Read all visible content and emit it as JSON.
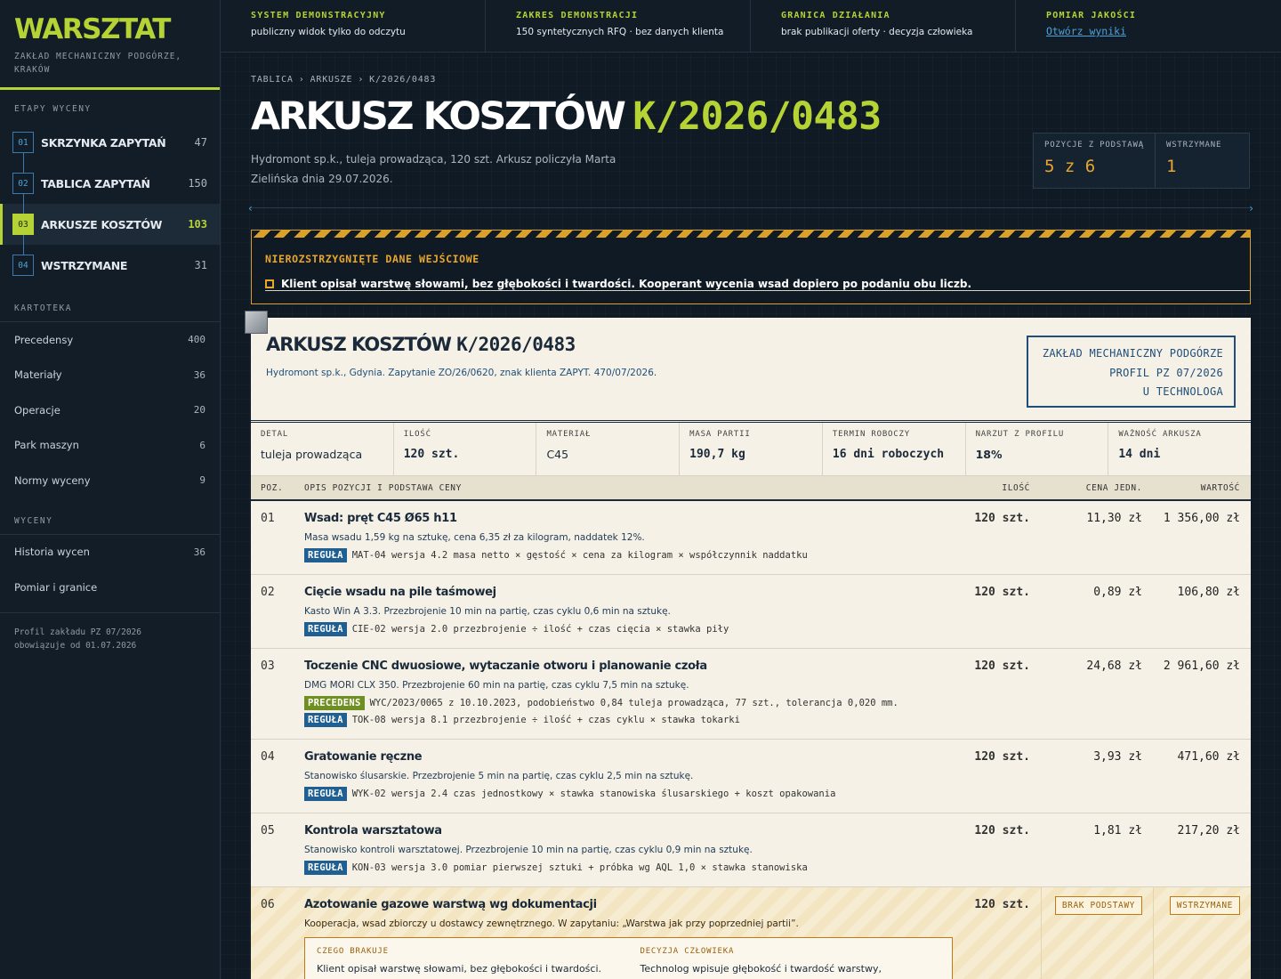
{
  "brand": {
    "name": "WARSZTAT",
    "subtitle": "ZAKŁAD MECHANICZNY PODGÓRZE, KRAKÓW"
  },
  "sidebar": {
    "stages_title": "ETAPY WYCENY",
    "stages": [
      {
        "num": "01",
        "label": "SKRZYNKA ZAPYTAŃ",
        "count": "47"
      },
      {
        "num": "02",
        "label": "TABLICA ZAPYTAŃ",
        "count": "150"
      },
      {
        "num": "03",
        "label": "ARKUSZE KOSZTÓW",
        "count": "103"
      },
      {
        "num": "04",
        "label": "WSTRZYMANE",
        "count": "31"
      }
    ],
    "kartoteka_title": "KARTOTEKA",
    "kartoteka": [
      {
        "label": "Precedensy",
        "count": "400"
      },
      {
        "label": "Materiały",
        "count": "36"
      },
      {
        "label": "Operacje",
        "count": "20"
      },
      {
        "label": "Park maszyn",
        "count": "6"
      },
      {
        "label": "Normy wyceny",
        "count": "9"
      }
    ],
    "wyceny_title": "WYCENY",
    "wyceny": [
      {
        "label": "Historia wycen",
        "count": "36"
      },
      {
        "label": "Pomiar i granice",
        "count": ""
      }
    ],
    "footer_line1": "Profil zakładu PZ 07/2026",
    "footer_line2": "obowiązuje od 01.07.2026"
  },
  "topbar": [
    {
      "title": "SYSTEM DEMONSTRACYJNY",
      "value": "publiczny widok tylko do odczytu"
    },
    {
      "title": "ZAKRES DEMONSTRACJI",
      "value": "150 syntetycznych RFQ · bez danych klienta"
    },
    {
      "title": "GRANICA DZIAŁANIA",
      "value": "brak publikacji oferty · decyzja człowieka"
    },
    {
      "title": "POMIAR JAKOŚCI",
      "link": "Otwórz wyniki"
    }
  ],
  "breadcrumb": [
    "TABLICA",
    "ARKUSZE",
    "K/2026/0483"
  ],
  "breadcrumb_sep": "›",
  "page": {
    "title_a": "ARKUSZ KOSZTÓW",
    "title_b": "K/2026/0483",
    "subtitle": "Hydromont sp.k., tuleja prowadząca, 120 szt. Arkusz policzyła Marta Zielińska dnia 29.07.2026."
  },
  "stats": [
    {
      "label": "POZYCJE Z PODSTAWĄ",
      "value": "5 z 6"
    },
    {
      "label": "WSTRZYMANE",
      "value": "1"
    }
  ],
  "warning": {
    "title": "NIEROZSTRZYGNIĘTE DANE WEJŚCIOWE",
    "message": "Klient opisał warstwę słowami, bez głębokości i twardości. Kooperant wycenia wsad dopiero po podaniu obu liczb."
  },
  "sheet": {
    "title_a": "ARKUSZ KOSZTÓW",
    "title_b": "K/2026/0483",
    "subtitle": "Hydromont sp.k., Gdynia. Zapytanie ZO/26/0620, znak klienta ZAPYT. 470/07/2026.",
    "stamp": [
      "ZAKŁAD MECHANICZNY PODGÓRZE",
      "PROFIL PZ 07/2026",
      "U TECHNOLOGA"
    ],
    "info": [
      {
        "k": "DETAL",
        "v": "tuleja prowadząca"
      },
      {
        "k": "ILOŚĆ",
        "v": "120 szt."
      },
      {
        "k": "MATERIAŁ",
        "v": "C45"
      },
      {
        "k": "MASA PARTII",
        "v": "190,7 kg"
      },
      {
        "k": "TERMIN ROBOCZY",
        "v": "16 dni roboczych"
      },
      {
        "k": "NARZUT Z PROFILU",
        "v": "18%"
      },
      {
        "k": "WAŻNOŚĆ ARKUSZA",
        "v": "14 dni"
      }
    ],
    "columns": {
      "poz": "POZ.",
      "desc": "OPIS POZYCJI I PODSTAWA CENY",
      "qty": "ILOŚĆ",
      "unit": "CENA JEDN.",
      "val": "WARTOŚĆ"
    },
    "rows": [
      {
        "poz": "01",
        "name": "Wsad: pręt C45 Ø65 h11",
        "desc": "Masa wsadu 1,59 kg na sztukę, cena 6,35 zł za kilogram, naddatek 12%.",
        "tag": "REGUŁA",
        "rule": "MAT-04 wersja 4.2 masa netto × gęstość × cena za kilogram × współczynnik naddatku",
        "qty": "120 szt.",
        "unit": "11,30 zł",
        "val": "1 356,00 zł"
      },
      {
        "poz": "02",
        "name": "Cięcie wsadu na pile taśmowej",
        "desc": "Kasto Win A 3.3. Przezbrojenie 10 min na partię, czas cyklu 0,6 min na sztukę.",
        "tag": "REGUŁA",
        "rule": "CIE-02 wersja 2.0 przezbrojenie ÷ ilość + czas cięcia × stawka piły",
        "qty": "120 szt.",
        "unit": "0,89 zł",
        "val": "106,80 zł"
      },
      {
        "poz": "03",
        "name": "Toczenie CNC dwuosiowe, wytaczanie otworu i planowanie czoła",
        "desc": "DMG MORI CLX 350. Przezbrojenie 60 min na partię, czas cyklu 7,5 min na sztukę.",
        "tag2": "PRECEDENS",
        "rule2": "WYC/2023/0065 z 10.10.2023, podobieństwo 0,84 tuleja prowadząca, 77 szt., tolerancja 0,020 mm.",
        "tag": "REGUŁA",
        "rule": "TOK-08 wersja 8.1 przezbrojenie ÷ ilość + czas cyklu × stawka tokarki",
        "qty": "120 szt.",
        "unit": "24,68 zł",
        "val": "2 961,60 zł"
      },
      {
        "poz": "04",
        "name": "Gratowanie ręczne",
        "desc": "Stanowisko ślusarskie. Przezbrojenie 5 min na partię, czas cyklu 2,5 min na sztukę.",
        "tag": "REGUŁA",
        "rule": "WYK-02 wersja 2.4 czas jednostkowy × stawka stanowiska ślusarskiego + koszt opakowania",
        "qty": "120 szt.",
        "unit": "3,93 zł",
        "val": "471,60 zł"
      },
      {
        "poz": "05",
        "name": "Kontrola warsztatowa",
        "desc": "Stanowisko kontroli warsztatowej. Przezbrojenie 10 min na partię, czas cyklu 0,9 min na sztukę.",
        "tag": "REGUŁA",
        "rule": "KON-03 wersja 3.0 pomiar pierwszej sztuki + próbka wg AQL 1,0 × stawka stanowiska",
        "qty": "120 szt.",
        "unit": "1,81 zł",
        "val": "217,20 zł"
      }
    ],
    "hold_row": {
      "poz": "06",
      "name": "Azotowanie gazowe warstwą wg dokumentacji",
      "desc": "Kooperacja, wsad zbiorczy u dostawcy zewnętrznego. W zapytaniu: „Warstwa jak przy poprzedniej partii”.",
      "qty": "120 szt.",
      "badge_unit": "BRAK PODSTAWY",
      "badge_val": "WSTRZYMANE",
      "missing_title": "CZEGO BRAKUJE",
      "missing_text": "Klient opisał warstwę słowami, bez głębokości i twardości. Kooperant wycenia wsad dopiero po podaniu obu liczb.",
      "decision_title": "DECYZJA CZŁOWIEKA",
      "decision_text": "Technolog wpisuje głębokość i twardość warstwy, zaopatrzenie pobiera cenę wsadu od kooperanta. Cena..."
    }
  }
}
